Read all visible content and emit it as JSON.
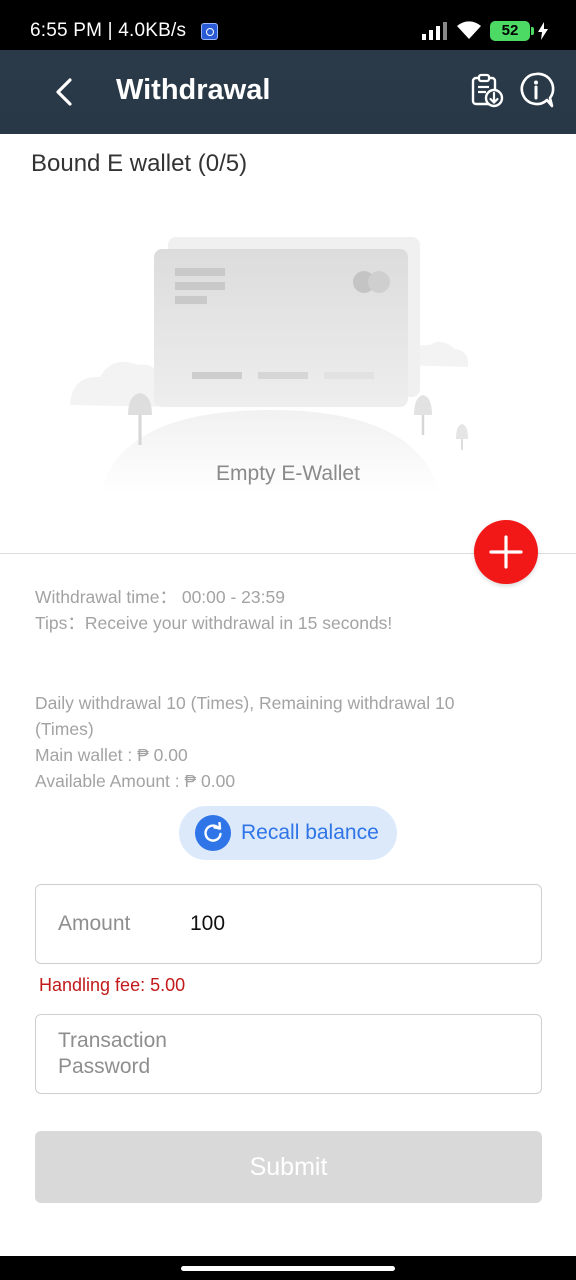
{
  "status_bar": {
    "time": "6:55 PM | 4.0KB/s",
    "battery": "52"
  },
  "app_bar": {
    "title": "Withdrawal"
  },
  "ewallet": {
    "title": "Bound E wallet (0/5)",
    "empty_text": "Empty E-Wallet"
  },
  "info": {
    "withdrawal_time": "Withdrawal time：  00:00 - 23:59",
    "tips": "Tips：Receive your withdrawal in 15 seconds!",
    "daily_limit": "Daily withdrawal 10 (Times), Remaining withdrawal 10 (Times)",
    "main_wallet": "Main wallet : ₱ 0.00",
    "available": "Available Amount : ₱ 0.00"
  },
  "recall": {
    "label": "Recall balance"
  },
  "form": {
    "amount_label": "Amount",
    "amount_value": "100",
    "handling_fee": "Handling fee: 5.00",
    "password_label_line1": "Transaction",
    "password_label_line2": "Password",
    "submit_label": "Submit"
  },
  "colors": {
    "app_bar": "#283846",
    "add_button": "#f21818",
    "recall_accent": "#2f75e8",
    "fee_text": "#c21a1a",
    "submit_disabled": "#d9d9d9"
  }
}
